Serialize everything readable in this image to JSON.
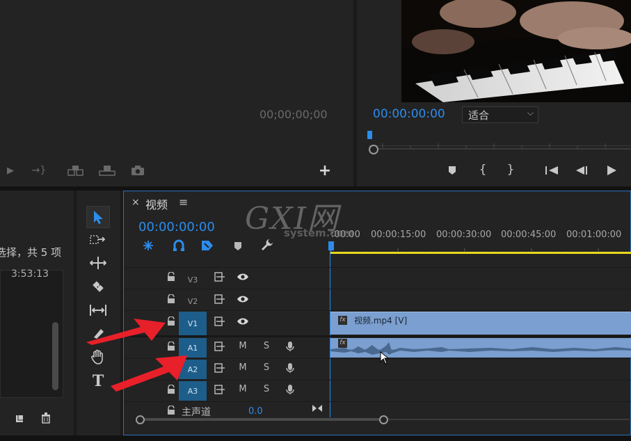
{
  "source_monitor": {
    "timecode": "00;00;00;00",
    "controls": [
      "step-back-icon",
      "insert-icon",
      "overwrite-icon",
      "export-frame-icon",
      "camera-icon"
    ],
    "add_label": "+"
  },
  "program_monitor": {
    "timecode": "00:00:00:00",
    "fit_label": "适合",
    "chevron": "⌵"
  },
  "project_panel": {
    "selection_text": "选择，共 5 项",
    "duration": "3:53:13"
  },
  "timeline": {
    "close_label": "×",
    "title": "视频",
    "menu_label": "≡",
    "timecode": "00:00:00:00",
    "ruler_labels": [
      ":00:00",
      "00:00:15:00",
      "00:00:30:00",
      "00:00:45:00",
      "00:01:00:00"
    ],
    "tracks": {
      "v3": "V3",
      "v2": "V2",
      "v1": "V1",
      "a1": "A1",
      "a2": "A2",
      "a3": "A3",
      "mute": "M",
      "solo": "S"
    },
    "master_label": "主声道",
    "master_value": "0.0",
    "video_clip": "视频.mp4 [V]",
    "fx_label": "fx"
  },
  "watermark": {
    "big": "GXI网",
    "small": "system.com"
  },
  "tools": [
    "selection-tool",
    "track-select-tool",
    "ripple-tool",
    "razor-tool",
    "slip-tool",
    "pen-tool",
    "hand-tool",
    "type-tool"
  ],
  "colors": {
    "accent_blue": "#2d8ceb",
    "clip_blue": "#7a9fd0",
    "work_area_yellow": "#e8d81a",
    "arrow_red": "#e8202a"
  }
}
